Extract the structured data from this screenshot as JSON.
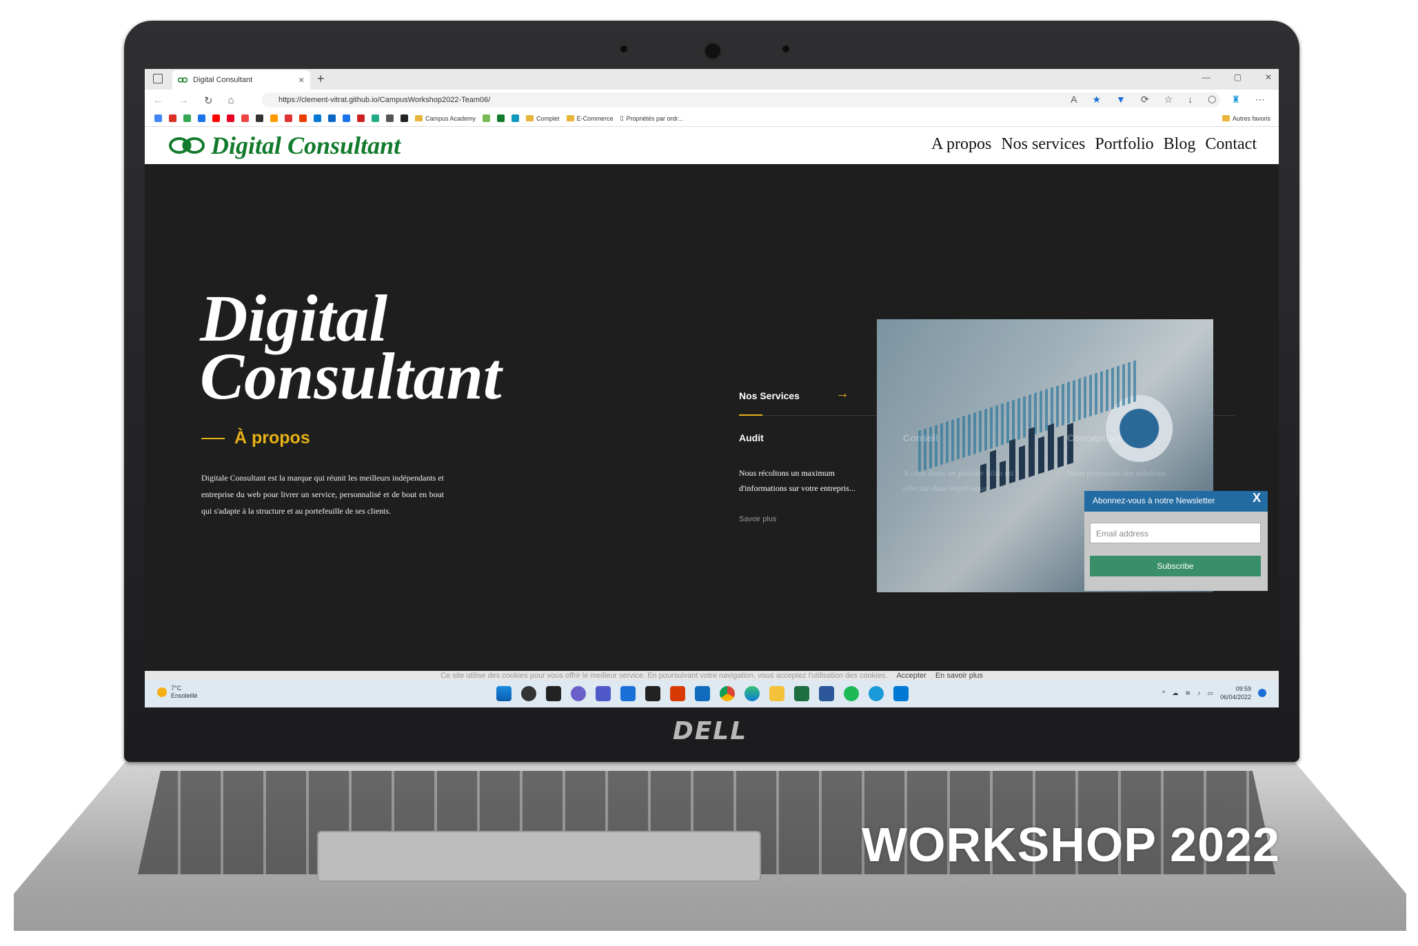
{
  "browser": {
    "tab_title": "Digital Consultant",
    "url": "https://clement-vitrat.github.io/CampusWorkshop2022-Team06/",
    "favorites": {
      "campus_academy": "Campus Academy",
      "complet": "Complet",
      "ecommerce": "E-Commerce",
      "proprietes": "Propriétés par ordr...",
      "autres": "Autres favoris"
    }
  },
  "site": {
    "logo": "Digital Consultant",
    "nav": [
      "A propos",
      "Nos services",
      "Portfolio",
      "Blog",
      "Contact"
    ],
    "hero": {
      "title_line1": "Digital",
      "title_line2": "Consultant",
      "subtitle": "À propos",
      "description": "Digitale Consultant est la marque qui réunit les meilleurs indépendants et entreprise du web pour livrer un service, personnalisé et de bout en bout qui s'adapte à la structure et au portefeuille de ses clients."
    },
    "services": {
      "tab_label": "Nos Services",
      "items": [
        {
          "title": "Audit",
          "text": "Nous récoltons un maximum d'informations sur votre entrepris...",
          "more": "Savoir plus"
        },
        {
          "title": "Conseil",
          "text": "A cette étape un premier bilan est effectué dans lequel nous"
        },
        {
          "title": "Conception",
          "text": "Nous proposons des solutions"
        }
      ]
    },
    "newsletter": {
      "title": "Abonnez-vous à notre Newsletter",
      "close": "X",
      "placeholder": "Email address",
      "button": "Subscribe"
    },
    "cookie": {
      "text": "Ce site utilise des cookies pour vous offrir le meilleur service. En poursuivant votre navigation, vous acceptez l'utilisation des cookies.",
      "accept": "Accepter",
      "more": "En savoir plus"
    }
  },
  "taskbar": {
    "temp": "7°C",
    "weather": "Ensoleillé",
    "time": "09:59",
    "date": "06/04/2022"
  },
  "laptop": {
    "brand": "DELL",
    "caption": "WORKSHOP 2022"
  },
  "colors": {
    "accent": "#e7b217",
    "logo_green": "#127a2c",
    "newsletter_header": "#236ba3",
    "subscribe": "#3a8f6b"
  }
}
